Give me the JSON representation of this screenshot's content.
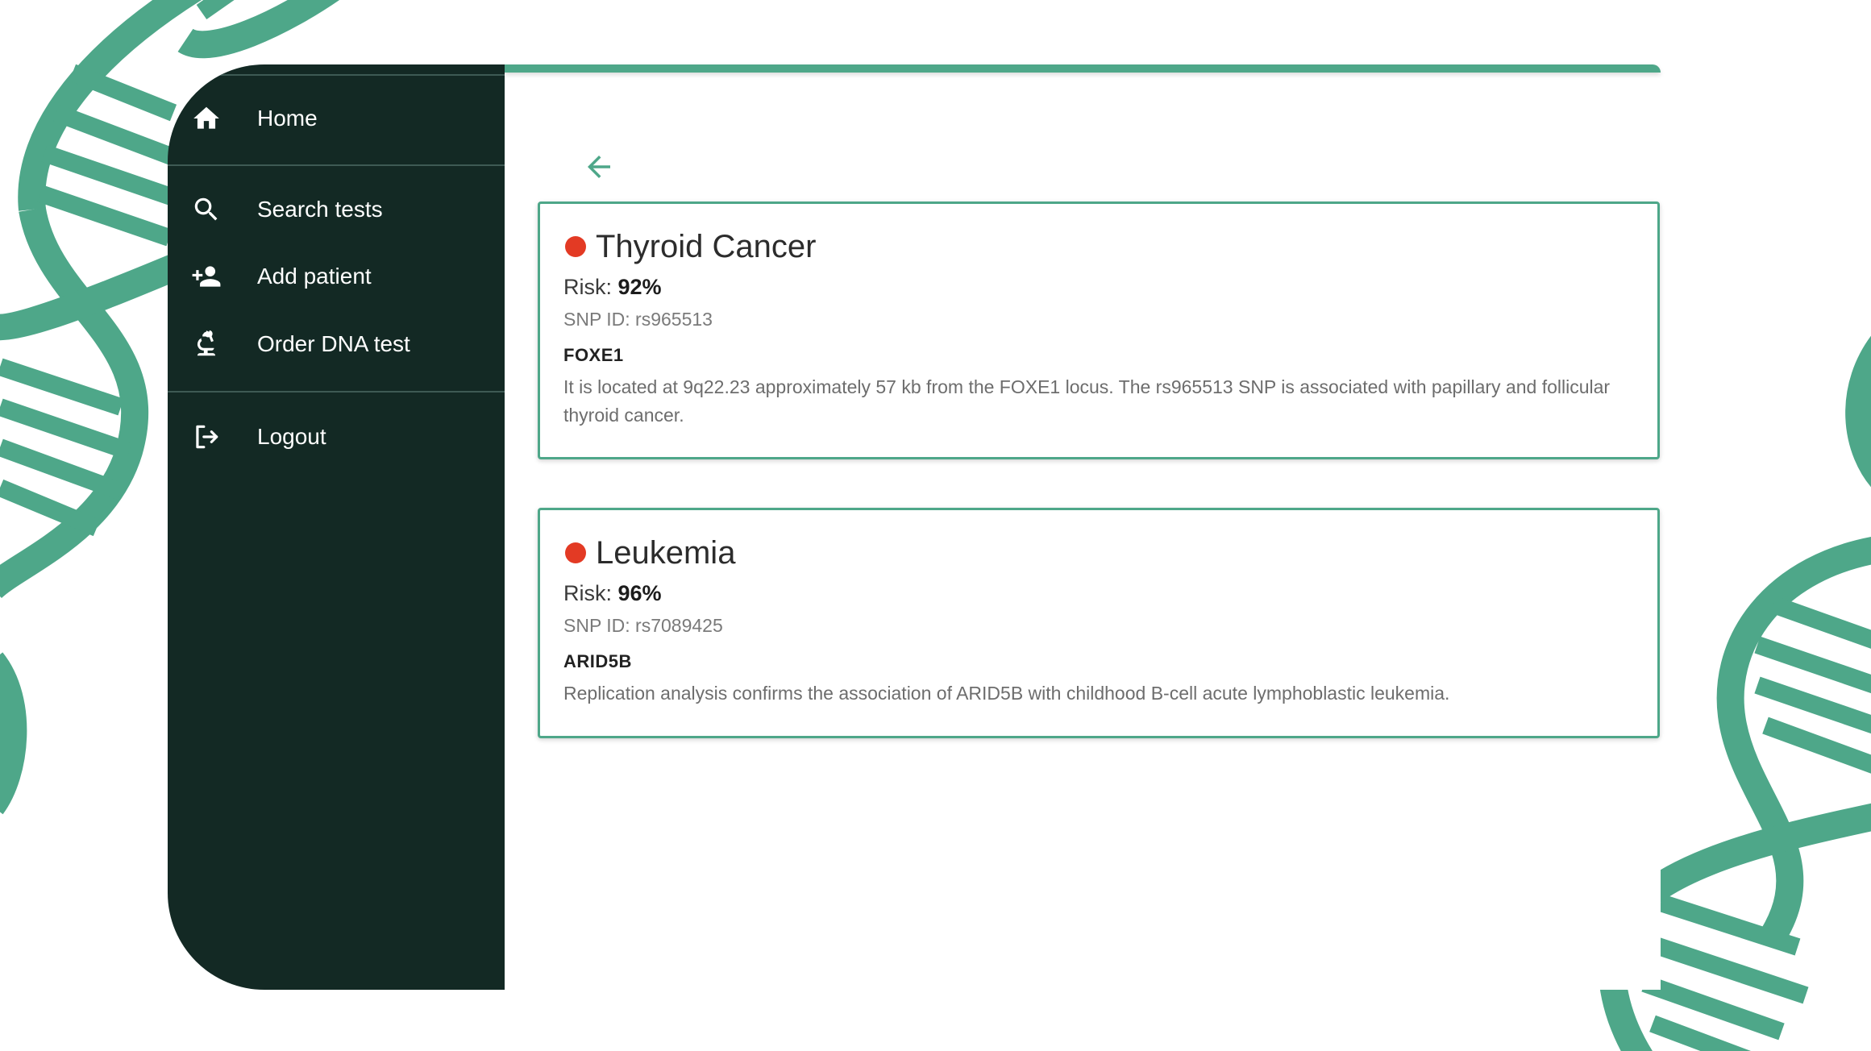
{
  "theme": {
    "accent": "#4ea789",
    "sidebar_bg": "#132924",
    "risk_dot": "#e33a24",
    "background": "#ffffff"
  },
  "sidebar": {
    "items": [
      {
        "id": "home",
        "label": "Home",
        "icon": "home-icon"
      },
      {
        "id": "search",
        "label": "Search tests",
        "icon": "search-icon"
      },
      {
        "id": "add-patient",
        "label": "Add patient",
        "icon": "add-person-icon"
      },
      {
        "id": "order-dna",
        "label": "Order DNA test",
        "icon": "microscope-icon"
      },
      {
        "id": "logout",
        "label": "Logout",
        "icon": "logout-icon"
      }
    ]
  },
  "main": {
    "back_icon": "arrow-left-icon",
    "results": [
      {
        "disease": "Thyroid Cancer",
        "risk_label": "Risk:",
        "risk_value": "92%",
        "snp": "SNP ID: rs965513",
        "gene": "FOXE1",
        "description": "It is located at 9q22.23 approximately 57 kb from the FOXE1 locus. The rs965513 SNP is associated with papillary and follicular thyroid cancer."
      },
      {
        "disease": "Leukemia",
        "risk_label": "Risk:",
        "risk_value": "96%",
        "snp": "SNP ID: rs7089425",
        "gene": "ARID5B",
        "description": "Replication analysis confirms the association of ARID5B with childhood B-cell acute lymphoblastic leukemia."
      }
    ]
  }
}
